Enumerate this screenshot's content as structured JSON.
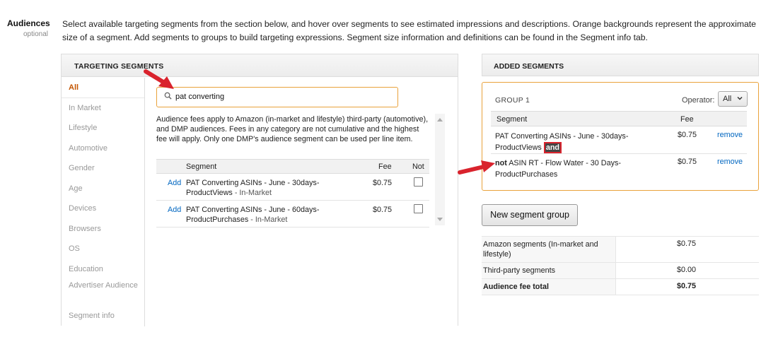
{
  "audiences": {
    "title": "Audiences",
    "optional": "optional",
    "description": "Select available targeting segments from the section below, and hover over segments to see estimated impressions and descriptions. Orange backgrounds represent the approximate size of a segment. Add segments to groups to build targeting expressions. Segment size information and definitions can be found in the Segment info tab."
  },
  "targeting": {
    "header": "TARGETING SEGMENTS",
    "categories": [
      "All",
      "In Market",
      "Lifestyle",
      "Automotive",
      "Gender",
      "Age",
      "Devices",
      "Browsers",
      "OS",
      "Education",
      "Advertiser Audience",
      "Segment info"
    ],
    "search": {
      "value": "pat converting",
      "icon": "search-icon"
    },
    "fee_note": "Audience fees apply to Amazon (in-market and lifestyle) third-party (automotive), and DMP audiences. Fees in any category are not cumulative and the highest fee will apply. Only one DMP's audience segment can be used per line item.",
    "columns": {
      "segment": "Segment",
      "fee": "Fee",
      "not": "Not"
    },
    "rows": [
      {
        "action": "Add",
        "name": "PAT Converting ASINs - June - 30days-ProductViews",
        "category": " - In-Market",
        "fee": "$0.75"
      },
      {
        "action": "Add",
        "name": "PAT Converting ASINs - June - 60days-ProductPurchases",
        "category": " - In-Market",
        "fee": "$0.75"
      }
    ]
  },
  "added": {
    "header": "ADDED SEGMENTS",
    "group_title": "GROUP 1",
    "operator_label": "Operator:",
    "operator_value": "All",
    "columns": {
      "segment": "Segment",
      "fee": "Fee"
    },
    "rows": [
      {
        "name": "PAT Converting ASINs - June - 30days-ProductViews",
        "joiner": "and",
        "fee": "$0.75",
        "action": "remove"
      },
      {
        "prefix": "not",
        "name": "ASIN RT - Flow Water - 30 Days-ProductPurchases",
        "fee": "$0.75",
        "action": "remove"
      }
    ],
    "new_group_button": "New segment group"
  },
  "totals": [
    {
      "label": "Amazon segments (In-market and lifestyle)",
      "value": "$0.75"
    },
    {
      "label": "Third-party segments",
      "value": "$0.00"
    },
    {
      "label": "Audience fee total",
      "value": "$0.75"
    }
  ],
  "colors": {
    "accent_orange": "#e9a23b",
    "link_blue": "#0066c0",
    "annotation_red": "#d9232d"
  }
}
